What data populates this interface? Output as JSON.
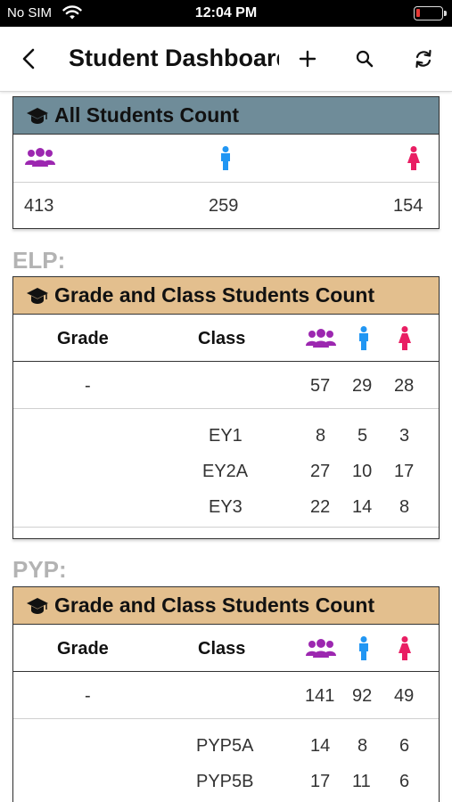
{
  "status_bar": {
    "carrier": "No SIM",
    "time": "12:04 PM",
    "battery_level_percent": 8
  },
  "nav": {
    "title": "Student Dashboard"
  },
  "colors": {
    "group_icon": "#9c27b0",
    "male_icon": "#2196f3",
    "female_icon": "#e91e63",
    "all_header": "#6f8c99",
    "grade_header": "#e3bf8e"
  },
  "all_students": {
    "title": "All Students Count",
    "total": "413",
    "male": "259",
    "female": "154"
  },
  "elp": {
    "label": "ELP:",
    "card_title": "Grade and Class Students Count",
    "col_grade": "Grade",
    "col_class": "Class",
    "summary": {
      "grade": "-",
      "total": "57",
      "male": "29",
      "female": "28"
    },
    "classes": [
      {
        "name": "EY1",
        "total": "8",
        "male": "5",
        "female": "3"
      },
      {
        "name": "EY2A",
        "total": "27",
        "male": "10",
        "female": "17"
      },
      {
        "name": "EY3",
        "total": "22",
        "male": "14",
        "female": "8"
      }
    ]
  },
  "pyp": {
    "label": "PYP:",
    "card_title": "Grade and Class Students Count",
    "col_grade": "Grade",
    "col_class": "Class",
    "summary": {
      "grade": "-",
      "total": "141",
      "male": "92",
      "female": "49"
    },
    "classes": [
      {
        "name": "PYP5A",
        "total": "14",
        "male": "8",
        "female": "6"
      },
      {
        "name": "PYP5B",
        "total": "17",
        "male": "11",
        "female": "6"
      }
    ]
  }
}
